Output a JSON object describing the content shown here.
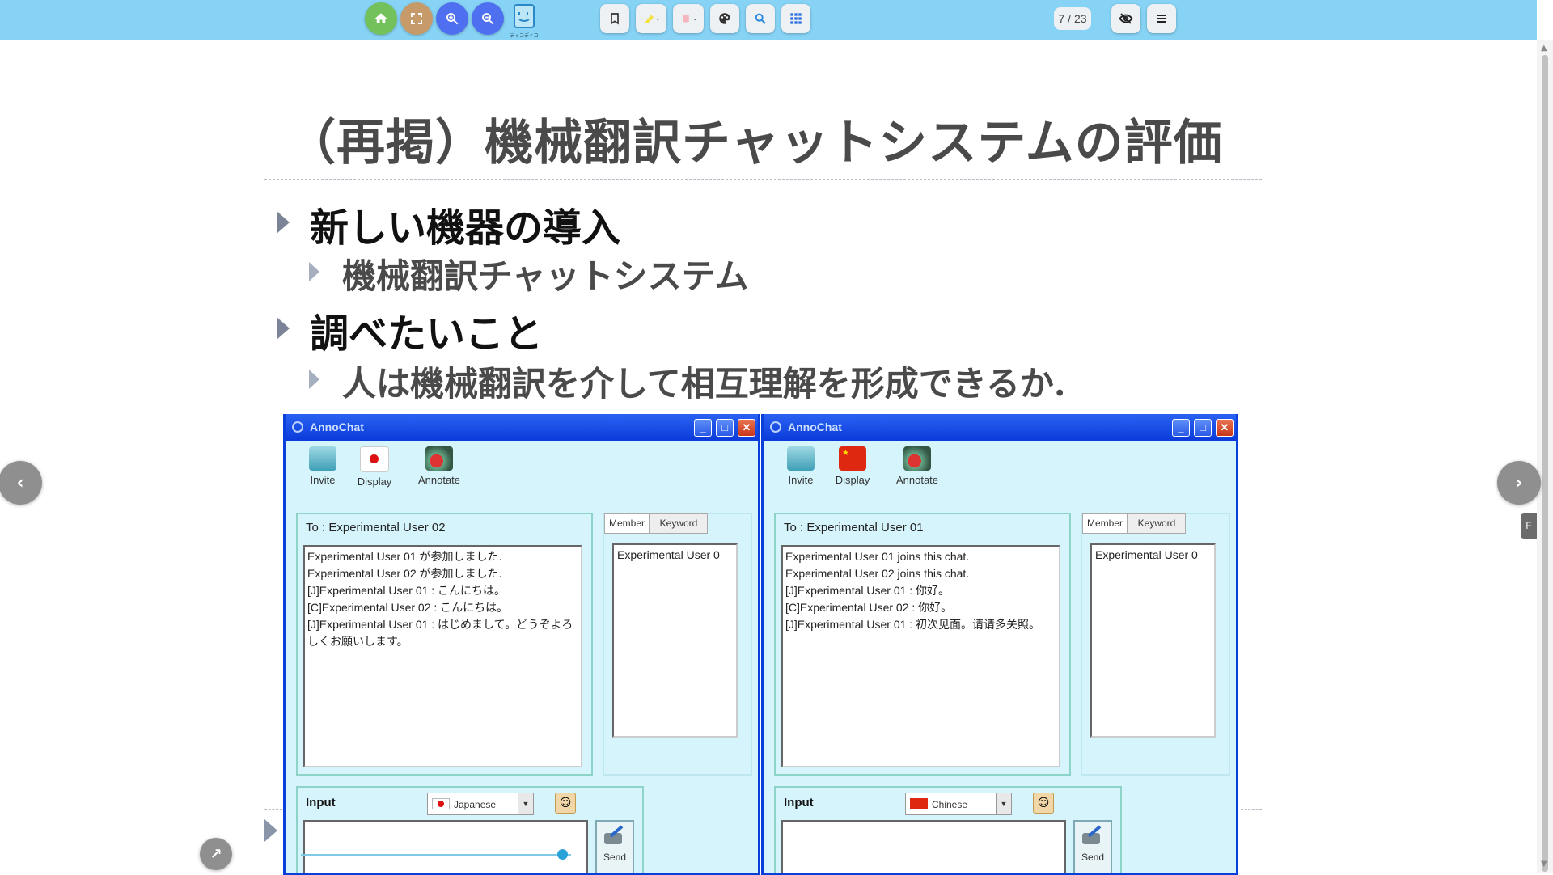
{
  "toolbar": {
    "left_buttons": [
      {
        "name": "home",
        "icon": "home-icon",
        "color": "#72c15a"
      },
      {
        "name": "fullscreen",
        "icon": "fullscreen-icon",
        "color": "#c79a6a"
      },
      {
        "name": "zoom-in",
        "icon": "zoom-in-icon",
        "color": "#4e6ff0"
      },
      {
        "name": "zoom-out",
        "icon": "zoom-out-icon",
        "color": "#4e6ff0"
      }
    ],
    "logo_text": "ディコディコ",
    "tools": [
      "bookmark-icon",
      "highlighter-icon",
      "eraser-icon",
      "palette-icon",
      "search-icon",
      "grid-icon"
    ],
    "page_indicator": "7 / 23",
    "right_buttons": [
      "hide-icon",
      "menu-icon"
    ]
  },
  "slide": {
    "title": "（再掲）機械翻訳チャットシステムの評価",
    "bullets": [
      {
        "level": 1,
        "text": "新しい機器の導入"
      },
      {
        "level": 2,
        "text": "機械翻訳チャットシステム"
      },
      {
        "level": 1,
        "text": "調べたいこと"
      },
      {
        "level": 2,
        "text": "人は機械翻訳を介して相互理解を形成できるか."
      }
    ]
  },
  "chat_windows": [
    {
      "title": "AnnoChat",
      "tools": [
        "Invite",
        "Display",
        "Annotate"
      ],
      "to": "To : Experimental User 02",
      "log": [
        "Experimental User 01 が参加しました.",
        "Experimental User 02 が参加しました.",
        "[J]Experimental User 01 : こんにちは。",
        "[C]Experimental User 02 : こんにちは。",
        "[J]Experimental User 01 : はじめまして。どうぞよろしくお願いします。"
      ],
      "tabs": [
        "Member",
        "Keyword"
      ],
      "member": "Experimental User 0",
      "input_label": "Input",
      "language": "Japanese",
      "flag": "japan",
      "send": "Send"
    },
    {
      "title": "AnnoChat",
      "tools": [
        "Invite",
        "Display",
        "Annotate"
      ],
      "to": "To : Experimental User 01",
      "log": [
        "Experimental User 01 joins this chat.",
        "Experimental User 02 joins this chat.",
        "[J]Experimental User 01 : 你好。",
        "[C]Experimental User 02 : 你好。",
        "[J]Experimental User 01 : 初次见面。请请多关照。"
      ],
      "tabs": [
        "Member",
        "Keyword"
      ],
      "member": "Experimental User 0",
      "input_label": "Input",
      "language": "Chinese",
      "flag": "china",
      "send": "Send"
    }
  ],
  "navigation": {
    "prev": "‹",
    "next": "›",
    "side_tab": "F",
    "corner_button": "↗"
  }
}
